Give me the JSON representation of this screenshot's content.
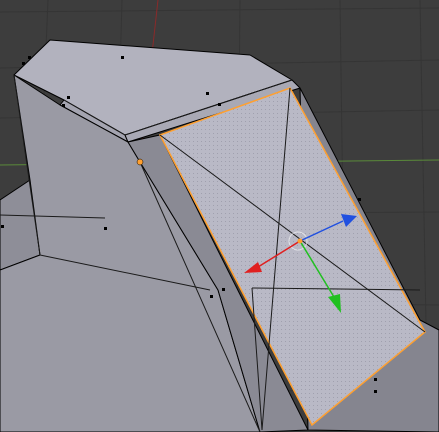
{
  "viewport": {
    "background_color": "#3d3d3d",
    "grid_color": "#353535",
    "x_axis_color": "#5a8a3a",
    "z_axis_color": "#8a2a2a",
    "mesh_face_color": "#9a9aa4",
    "mesh_top_color": "#b4b4c0",
    "mesh_dark_color": "#7b7b84",
    "selected_face_color": "#b9b9c6",
    "selection_outline_color": "#ffa030",
    "edge_color": "#000000"
  },
  "transform_gizmo": {
    "x_arrow_color": "#e02020",
    "y_arrow_color": "#20c020",
    "z_arrow_color": "#2050e0",
    "center_color": "#ffa030"
  },
  "icons": [
    "move-gizmo-icon",
    "pivot-point-icon"
  ]
}
